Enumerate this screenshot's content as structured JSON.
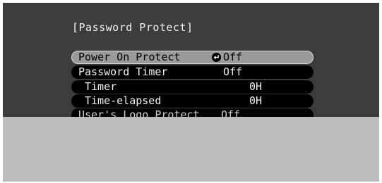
{
  "title": "[Password Protect]",
  "menu": [
    {
      "label": "Power On Protect",
      "value": "Off"
    },
    {
      "label": "Password Timer",
      "value": "Off"
    },
    {
      "label": "Timer",
      "value": "0H"
    },
    {
      "label": "Time-elapsed",
      "value": "0H"
    },
    {
      "label": "User's Logo Protect",
      "value": "Off"
    }
  ],
  "icons": {
    "enter": "enter-icon"
  }
}
